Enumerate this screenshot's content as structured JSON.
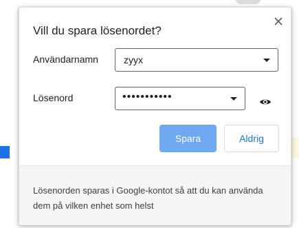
{
  "dialog": {
    "title": "Vill du spara lösenordet?",
    "username_label": "Användarnamn",
    "username_value": "zyyx",
    "password_label": "Lösenord",
    "password_value": "•••••••••••",
    "save_label": "Spara",
    "never_label": "Aldrig",
    "footer_text": "Lösenorden sparas i Google-kontot så att du kan använda dem på vilken enhet som helst"
  },
  "icons": {
    "close": "close-icon",
    "dropdown": "chevron-down-icon",
    "eye": "eye-icon"
  },
  "colors": {
    "primary_button": "#6ea8f0",
    "link_blue": "#1a73e8"
  }
}
